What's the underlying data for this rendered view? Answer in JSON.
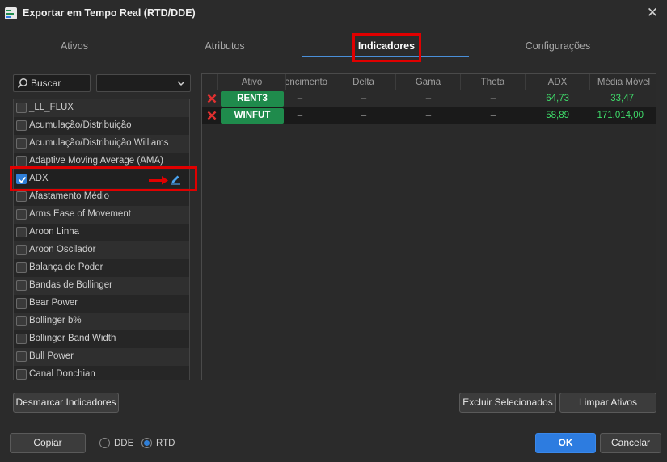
{
  "window": {
    "title": "Exportar em Tempo Real (RTD/DDE)"
  },
  "tabs": [
    {
      "label": "Ativos"
    },
    {
      "label": "Atributos"
    },
    {
      "label": "Indicadores"
    },
    {
      "label": "Configurações"
    }
  ],
  "search": {
    "placeholder": "Buscar"
  },
  "indicator_list": [
    {
      "label": "_LL_FLUX",
      "checked": false
    },
    {
      "label": "Acumulação/Distribuição",
      "checked": false
    },
    {
      "label": "Acumulação/Distribuição Williams",
      "checked": false
    },
    {
      "label": "Adaptive Moving Average (AMA)",
      "checked": false
    },
    {
      "label": "ADX",
      "checked": true
    },
    {
      "label": "Afastamento Médio",
      "checked": false
    },
    {
      "label": "Arms Ease of Movement",
      "checked": false
    },
    {
      "label": "Aroon Linha",
      "checked": false
    },
    {
      "label": "Aroon Oscilador",
      "checked": false
    },
    {
      "label": "Balança de Poder",
      "checked": false
    },
    {
      "label": "Bandas de Bollinger",
      "checked": false
    },
    {
      "label": "Bear Power",
      "checked": false
    },
    {
      "label": "Bollinger b%",
      "checked": false
    },
    {
      "label": "Bollinger Band Width",
      "checked": false
    },
    {
      "label": "Bull Power",
      "checked": false
    },
    {
      "label": "Canal Donchian",
      "checked": false
    }
  ],
  "grid": {
    "columns": [
      "Ativo",
      "encimento",
      "Delta",
      "Gama",
      "Theta",
      "ADX",
      "Média Móvel"
    ],
    "rows": [
      {
        "ativo": "RENT3",
        "vencimento": "–",
        "delta": "–",
        "gama": "–",
        "theta": "–",
        "adx": "64,73",
        "media_movel": "33,47"
      },
      {
        "ativo": "WINFUT",
        "vencimento": "–",
        "delta": "–",
        "gama": "–",
        "theta": "–",
        "adx": "58,89",
        "media_movel": "171.014,00"
      }
    ]
  },
  "buttons": {
    "desmarcar": "Desmarcar Indicadores",
    "excluir": "Excluir Selecionados",
    "limpar": "Limpar Ativos",
    "copiar": "Copiar",
    "ok": "OK",
    "cancelar": "Cancelar"
  },
  "radio": {
    "dde": "DDE",
    "rtd": "RTD",
    "selected": "RTD"
  },
  "colors": {
    "accent": "#2d7ce0",
    "ticker_bg": "#1f8b4c",
    "value_green": "#3fdc6a",
    "highlight": "#e00000"
  }
}
